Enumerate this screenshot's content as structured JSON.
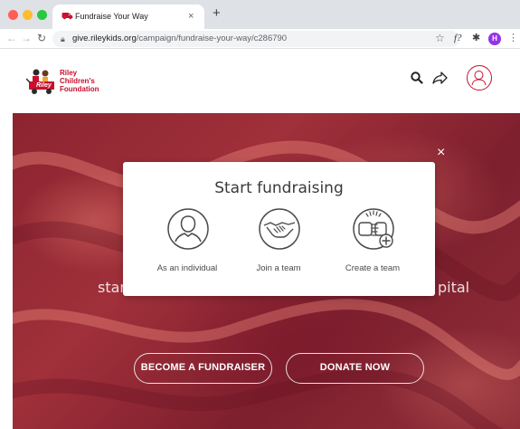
{
  "browser": {
    "tab_title": "Fundraise Your Way",
    "tab_close": "×",
    "new_tab": "+",
    "url_domain": "give.rileykids.org",
    "url_path": "/campaign/fundraise-your-way/c286790",
    "extension_f_label": "f?",
    "profile_initial": "H"
  },
  "site": {
    "logo_lines": [
      "Riley",
      "Children's",
      "Foundation"
    ],
    "logo_wagon_text": "Riley",
    "brand_color": "#c8102e"
  },
  "hero": {
    "text_left": "star",
    "text_right": "pital",
    "close": "×",
    "buttons": {
      "fundraiser": "BECOME A FUNDRAISER",
      "donate": "DONATE NOW"
    }
  },
  "modal": {
    "title": "Start fundraising",
    "options": [
      {
        "label": "As an individual",
        "icon": "person-icon"
      },
      {
        "label": "Join a team",
        "icon": "handshake-icon"
      },
      {
        "label": "Create a team",
        "icon": "fist-bump-add-icon"
      }
    ]
  },
  "icons": {
    "search": "search-icon",
    "share": "share-icon",
    "account": "account-icon"
  }
}
